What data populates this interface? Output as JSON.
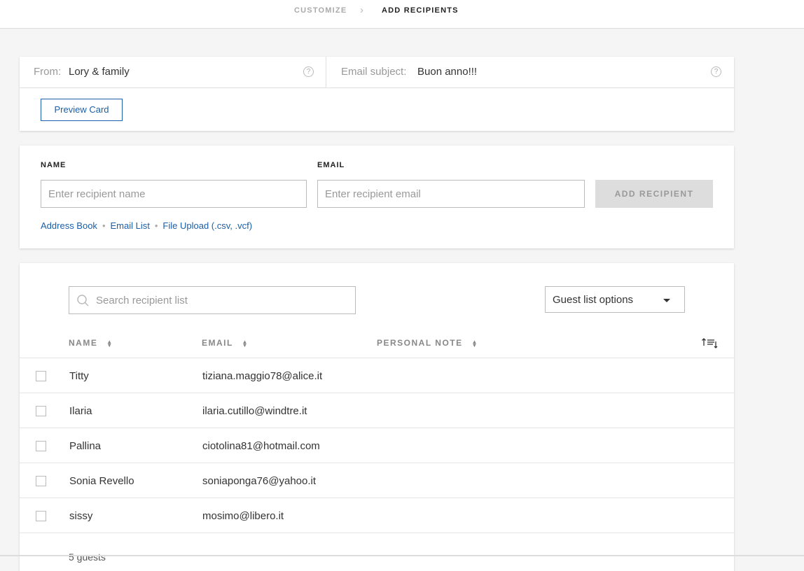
{
  "breadcrumb": {
    "step1": "CUSTOMIZE",
    "step2": "ADD RECIPIENTS",
    "separator": "›"
  },
  "envelope": {
    "from_label": "From:",
    "from_value": "Lory & family",
    "subject_label": "Email subject:",
    "subject_value": "Buon anno!!!",
    "help_glyph": "?",
    "preview_button": "Preview Card"
  },
  "add_form": {
    "name_label": "NAME",
    "email_label": "EMAIL",
    "name_placeholder": "Enter recipient name",
    "email_placeholder": "Enter recipient email",
    "add_button": "ADD RECIPIENT",
    "links": [
      "Address Book",
      "Email List",
      "File Upload (.csv, .vcf)"
    ],
    "link_separator": "•"
  },
  "recipients": {
    "search_placeholder": "Search recipient list",
    "guest_options_label": "Guest list options",
    "columns": [
      "NAME",
      "EMAIL",
      "PERSONAL NOTE"
    ],
    "rows": [
      {
        "name": "Titty",
        "email": "tiziana.maggio78@alice.it"
      },
      {
        "name": "Ilaria",
        "email": "ilaria.cutillo@windtre.it"
      },
      {
        "name": "Pallina",
        "email": "ciotolina81@hotmail.com"
      },
      {
        "name": "Sonia Revello",
        "email": "soniaponga76@yahoo.it"
      },
      {
        "name": "sissy",
        "email": "mosimo@libero.it"
      }
    ],
    "footer": "5 guests"
  },
  "colors": {
    "link_blue": "#1a5fa8",
    "disabled_button": "#dddddd",
    "background": "#f5f5f5"
  }
}
